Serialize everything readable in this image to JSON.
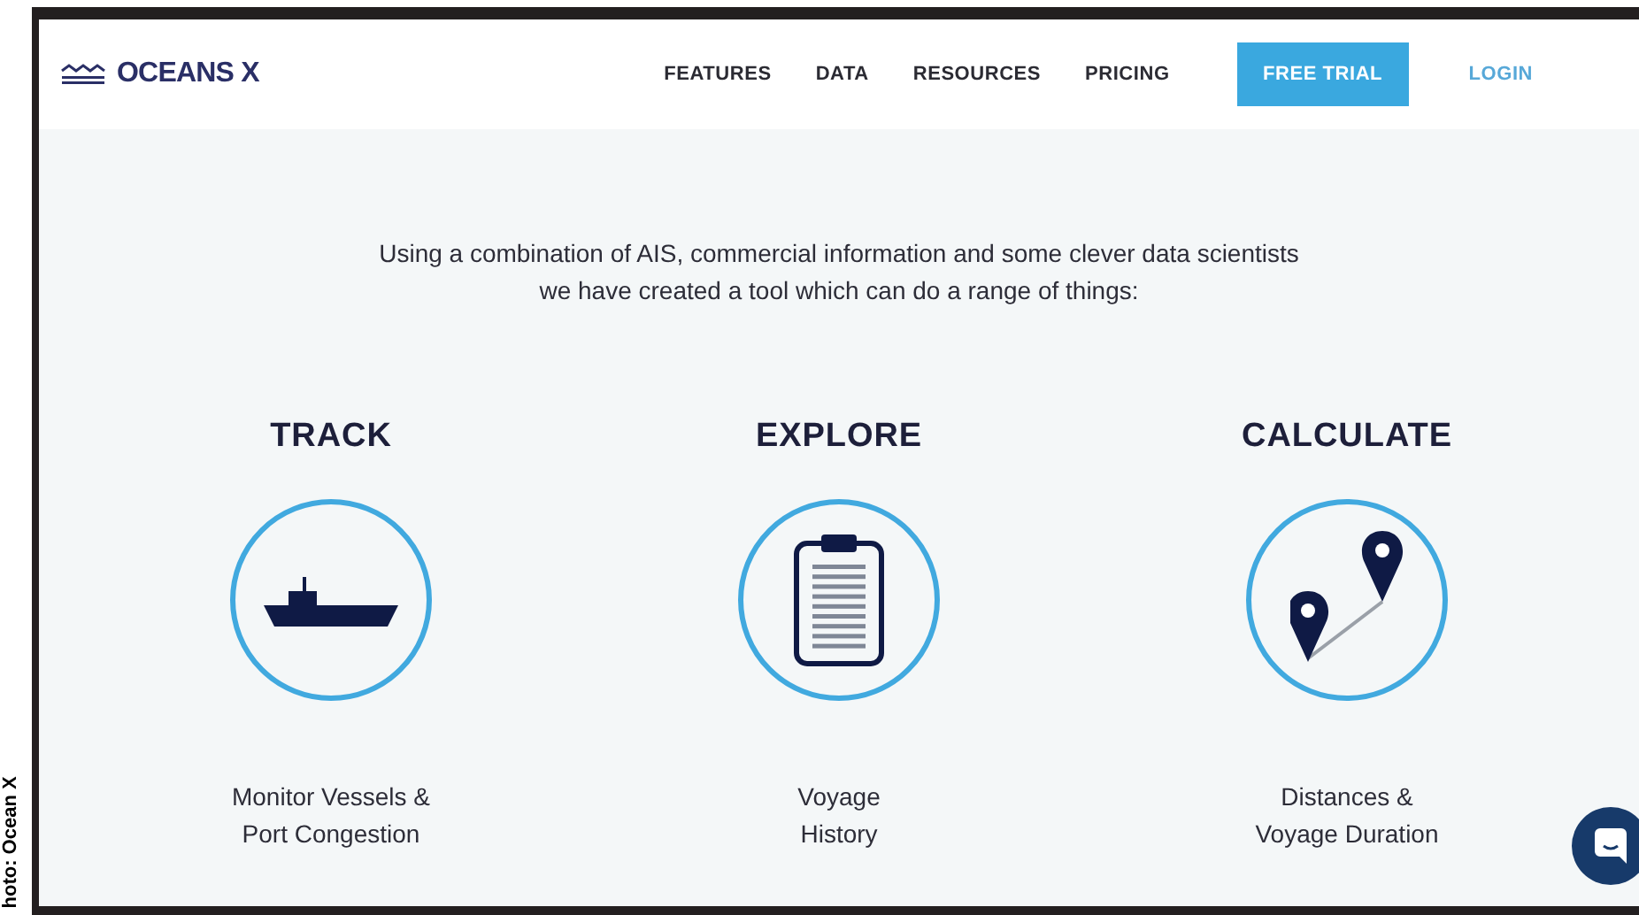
{
  "credit": "hoto: Ocean X",
  "header": {
    "logo": "OCEANS X",
    "nav": [
      "FEATURES",
      "DATA",
      "RESOURCES",
      "PRICING"
    ],
    "cta": "FREE TRIAL",
    "login": "LOGIN"
  },
  "intro": [
    "Using a combination of AIS, commercial information and some clever data scientists",
    "we have created a tool which can do a range of things:"
  ],
  "features": [
    {
      "kind": "ship",
      "title": "TRACK",
      "caption": [
        "Monitor Vessels &",
        "Port Congestion"
      ]
    },
    {
      "kind": "clipboard",
      "title": "EXPLORE",
      "caption": [
        "Voyage",
        "History"
      ]
    },
    {
      "kind": "pins",
      "title": "CALCULATE",
      "caption": [
        "Distances &",
        "Voyage Duration"
      ]
    }
  ]
}
